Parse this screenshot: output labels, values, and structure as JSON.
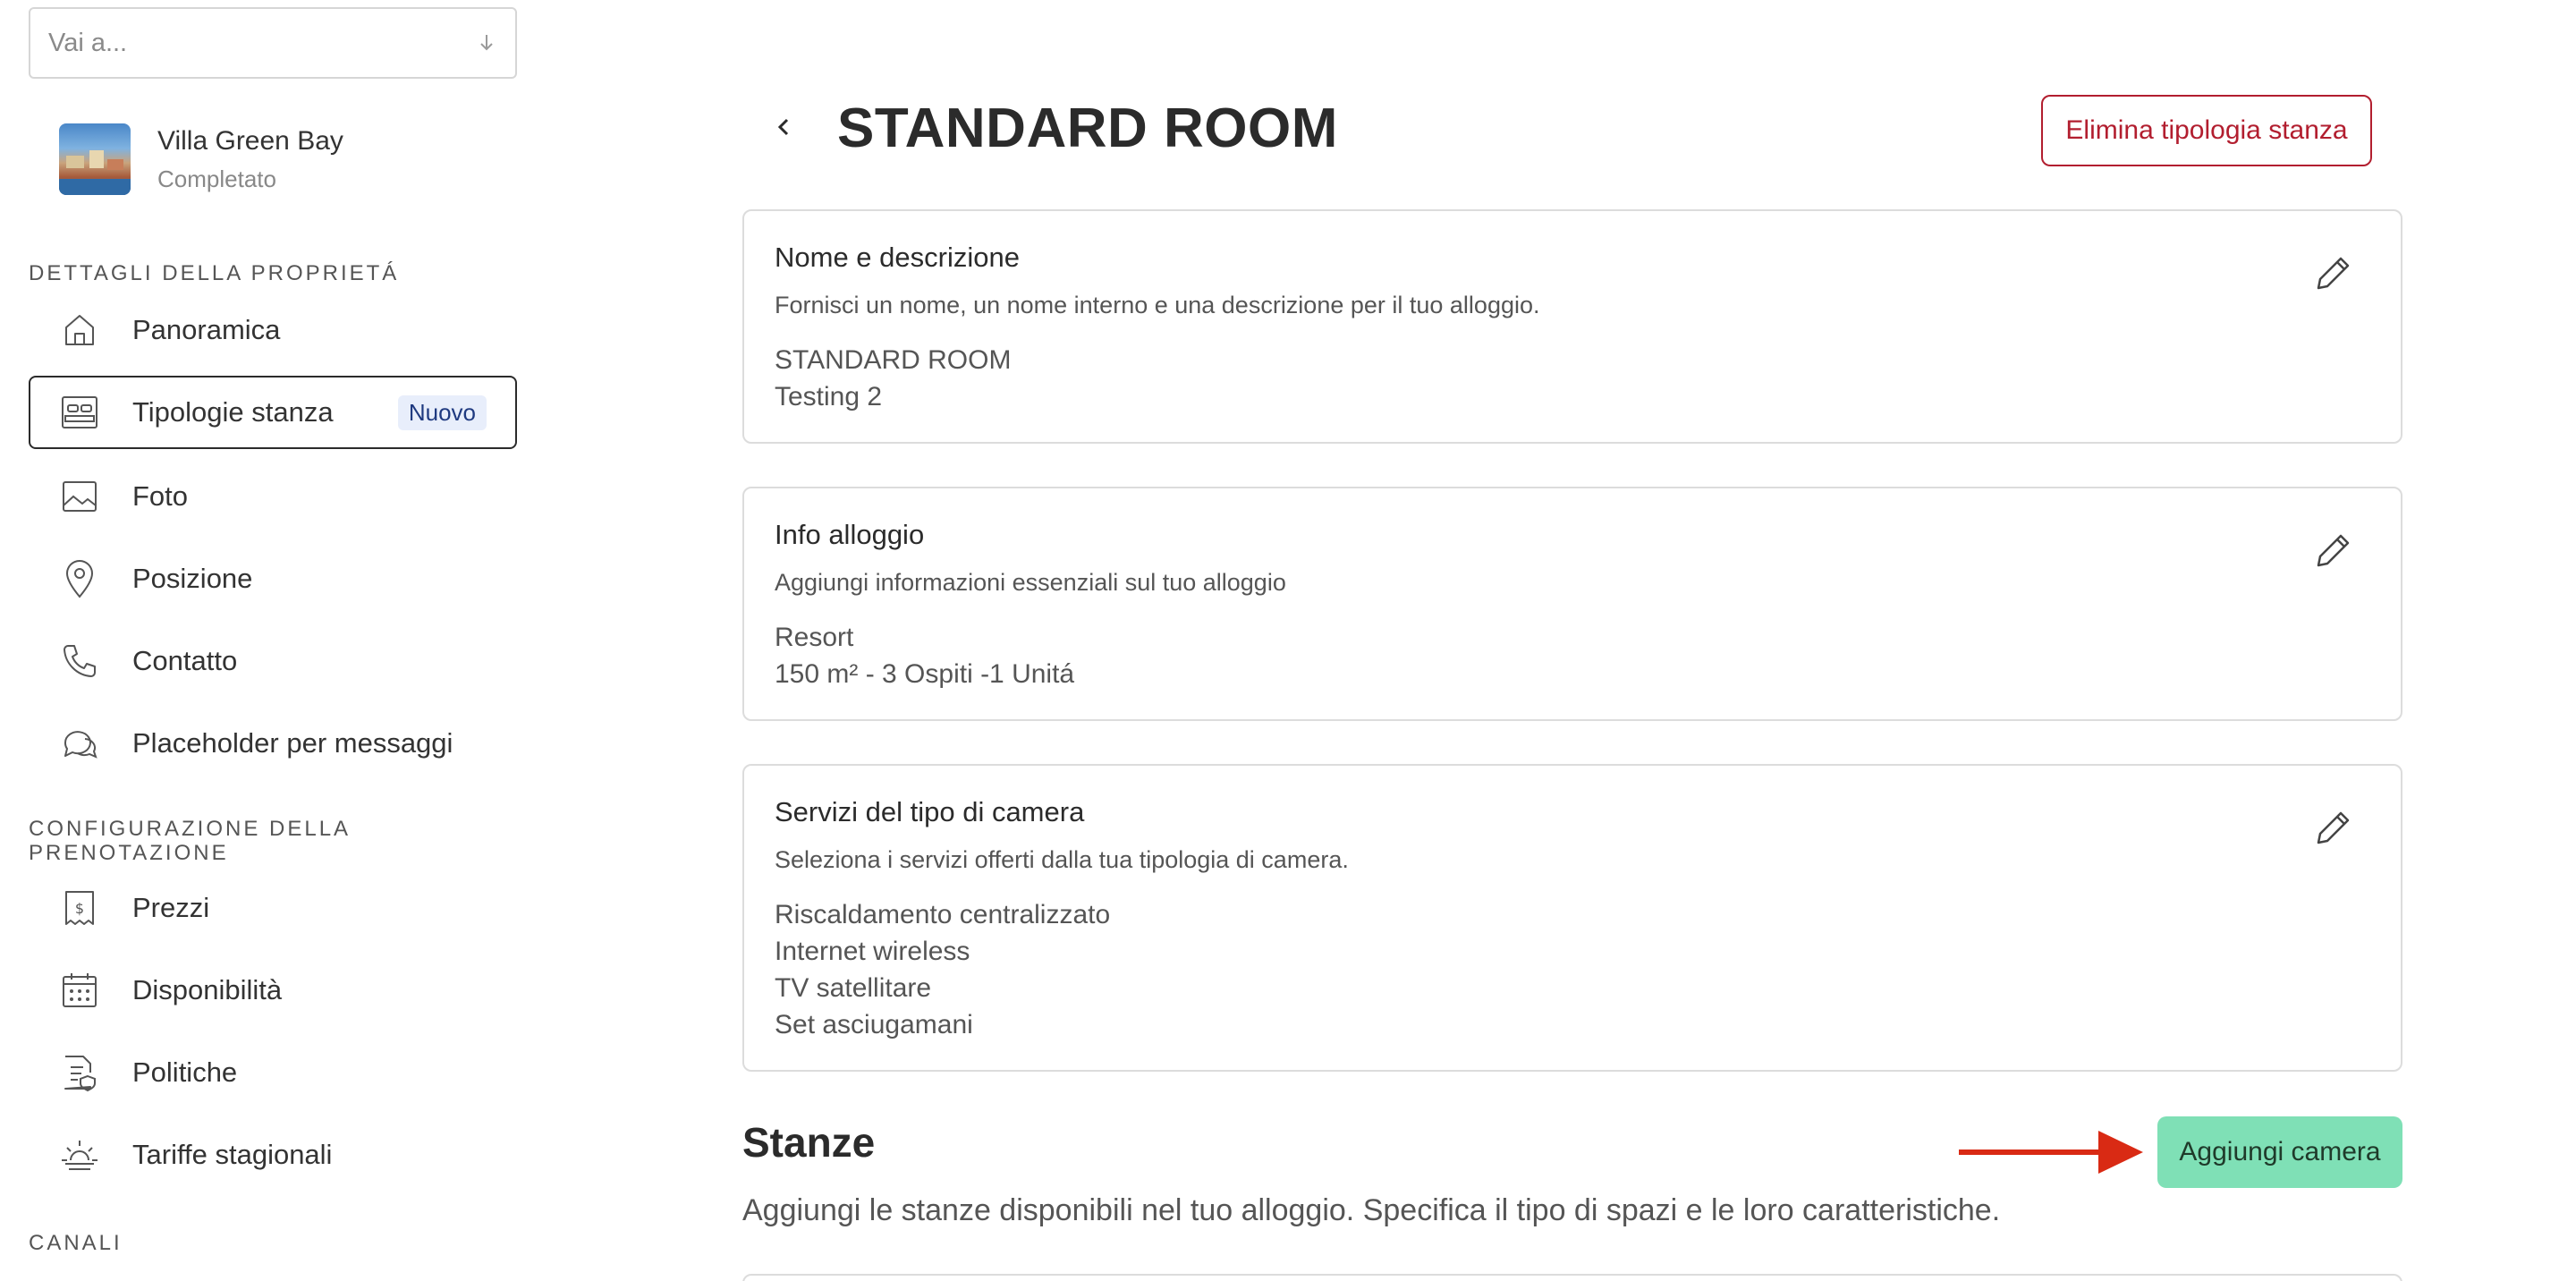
{
  "sidebar": {
    "goto_placeholder": "Vai a...",
    "property": {
      "name": "Villa Green Bay",
      "status": "Completato"
    },
    "sections": {
      "property_details": "DETTAGLI DELLA PROPRIETÁ",
      "booking_config_line1": "CONFIGURAZIONE DELLA",
      "booking_config_line2": "PRENOTAZIONE",
      "channels": "CANALI"
    },
    "items": {
      "overview": "Panoramica",
      "room_types": "Tipologie stanza",
      "room_types_badge": "Nuovo",
      "photos": "Foto",
      "location": "Posizione",
      "contact": "Contatto",
      "message_placeholders": "Placeholder per messaggi",
      "prices": "Prezzi",
      "availability": "Disponibilità",
      "policies": "Politiche",
      "seasonal_rates": "Tariffe stagionali"
    }
  },
  "main": {
    "title": "STANDARD ROOM",
    "delete_label": "Elimina tipologia stanza",
    "cards": [
      {
        "title": "Nome e descrizione",
        "description": "Fornisci un nome, un nome interno e una descrizione per il tuo alloggio.",
        "values": [
          "STANDARD ROOM",
          "Testing 2"
        ]
      },
      {
        "title": "Info alloggio",
        "description": "Aggiungi informazioni essenziali sul tuo alloggio",
        "values": [
          "Resort",
          "150 m² - 3 Ospiti -1 Unitá"
        ]
      },
      {
        "title": "Servizi del tipo di camera",
        "description": "Seleziona i servizi offerti dalla tua tipologia di camera.",
        "values": [
          "Riscaldamento centralizzato",
          "Internet wireless",
          "TV satellitare",
          "Set asciugamani"
        ]
      }
    ],
    "rooms": {
      "title": "Stanze",
      "description": "Aggiungi le stanze disponibili nel tuo alloggio. Specifica il tipo di spazi e le loro caratteristiche.",
      "add_label": "Aggiungi camera"
    }
  },
  "colors": {
    "accent_green": "#7fe0b6",
    "danger": "#b21e2f",
    "arrow": "#d92a14"
  }
}
